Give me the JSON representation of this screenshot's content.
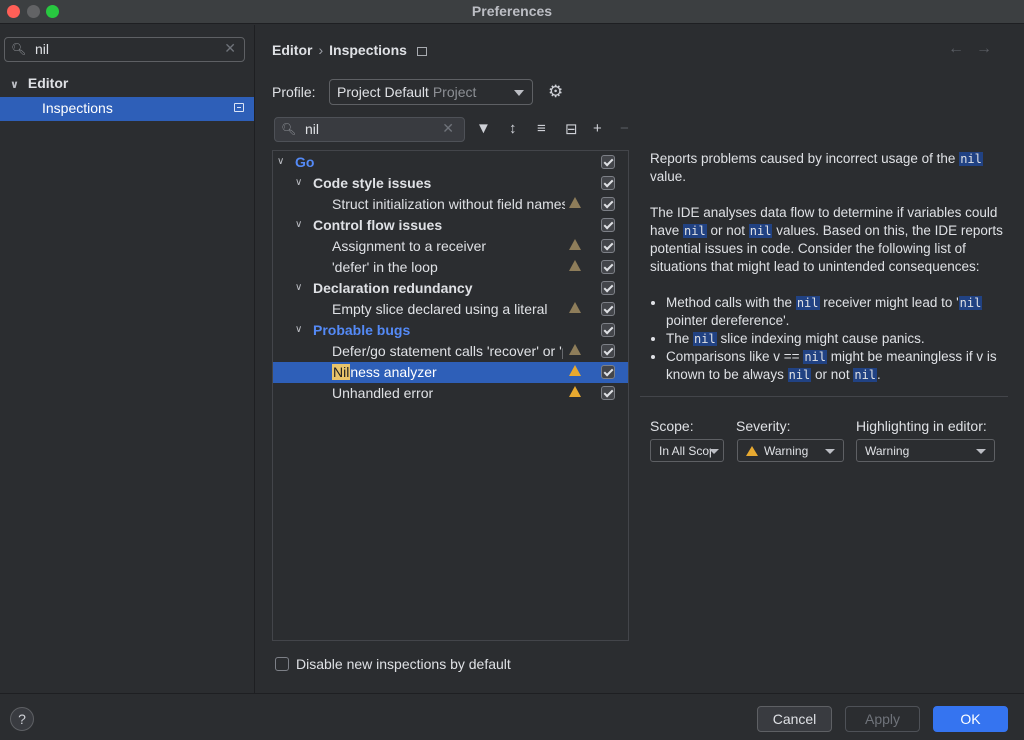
{
  "window": {
    "title": "Preferences"
  },
  "left": {
    "search_value": "nil",
    "tree": {
      "editor": "Editor",
      "inspections": "Inspections"
    }
  },
  "breadcrumb": {
    "part1": "Editor",
    "part2": "Inspections"
  },
  "profile": {
    "label": "Profile:",
    "name": "Project Default",
    "scope": "Project"
  },
  "inspection_search": "nil",
  "tree_rows": [
    {
      "text": "Go"
    },
    {
      "text": "Code style issues"
    },
    {
      "text": "Struct initialization without field names"
    },
    {
      "text": "Control flow issues"
    },
    {
      "text": "Assignment to a receiver"
    },
    {
      "text": "'defer' in the loop"
    },
    {
      "text": "Declaration redundancy"
    },
    {
      "text": "Empty slice declared using a literal"
    },
    {
      "text": "Probable bugs"
    },
    {
      "text": "Defer/go statement calls 'recover' or 'panic' directly"
    },
    {
      "text_hl": "Nil",
      "text_rest": "ness analyzer"
    },
    {
      "text": "Unhandled error"
    }
  ],
  "description": {
    "p1_a": "Reports problems caused by incorrect usage of the",
    "code": "nil",
    "p1_b": "value.",
    "p2_a": "The IDE analyses data flow to determine if variables could have",
    "p2_b": "or not",
    "p2_c": "values. Based on this, the IDE reports potential issues in code. Consider the following list of situations that might lead to unintended consequences:",
    "li1_a": "Method calls with the",
    "li1_b": "receiver might lead to '",
    "li1_c": "pointer dereference'.",
    "li2_a": "The",
    "li2_b": "slice indexing might cause panics.",
    "li3_a": "Comparisons like v  ==",
    "li3_b": "might be meaningless if v is known to be always",
    "li3_c": "or not",
    "li3_d": "."
  },
  "options": {
    "scope_label": "Scope:",
    "scope_value": "In All Scopes",
    "severity_label": "Severity:",
    "severity_value": "Warning",
    "highlight_label": "Highlighting in editor:",
    "highlight_value": "Warning"
  },
  "disable_new": "Disable new inspections by default",
  "buttons": {
    "help": "?",
    "cancel": "Cancel",
    "apply": "Apply",
    "ok": "OK"
  },
  "colors": {
    "accent": "#3574f0",
    "selection": "#2e5fb8",
    "warning": "#e7a930",
    "group_blue": "#548af7"
  }
}
